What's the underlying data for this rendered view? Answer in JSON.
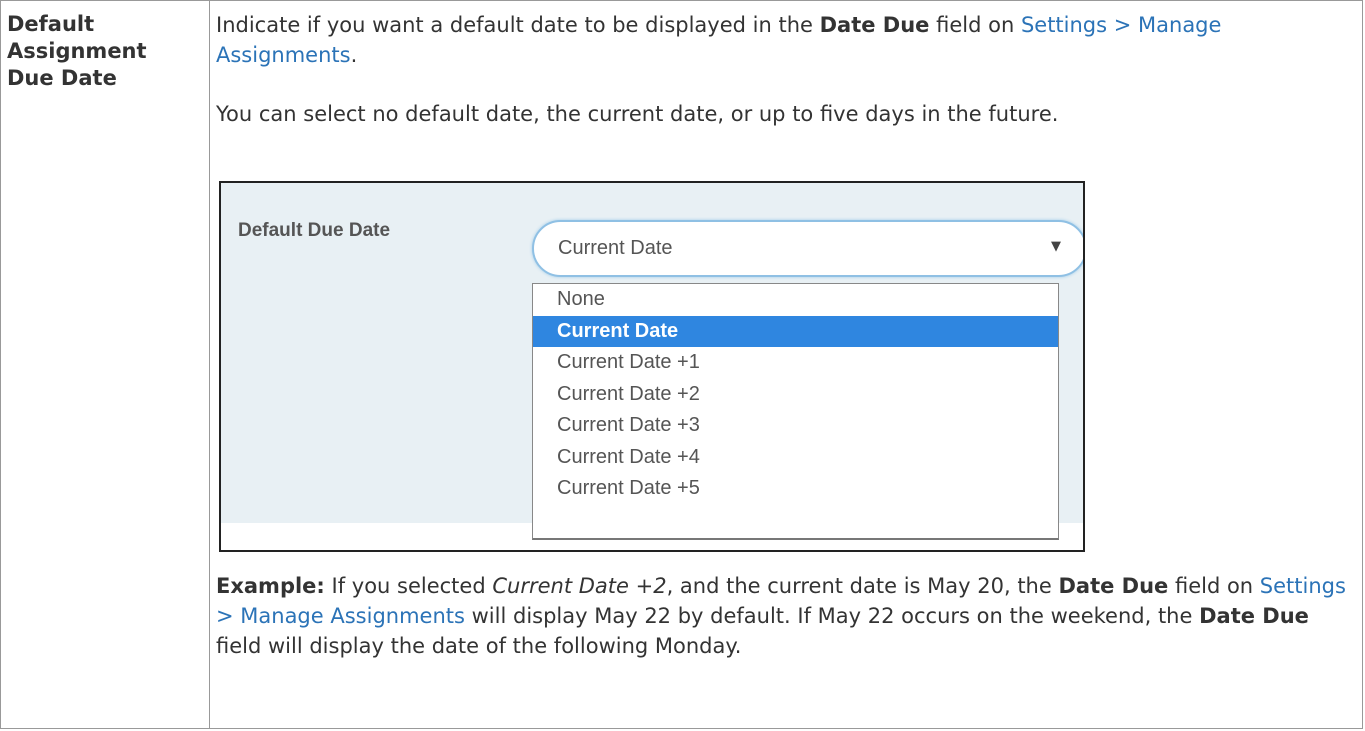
{
  "term": [
    "Default",
    "Assignment",
    "Due Date"
  ],
  "intro": {
    "pre": "Indicate if you want a default date to be displayed in the ",
    "bold": "Date Due",
    "mid": " field on ",
    "link": "Settings > Manage Assignments",
    "post": "."
  },
  "select_note": "You can select no default date, the current date, or up to five days in the future.",
  "dropdown": {
    "label": "Default Due Date",
    "value": "Current Date",
    "options": [
      "None",
      "Current Date",
      "Current Date +1",
      "Current Date +2",
      "Current Date +3",
      "Current Date +4",
      "Current Date +5"
    ],
    "selected_index": 1
  },
  "example": {
    "label": "Example:",
    "t1": " If you selected ",
    "italic": "Current Date +2",
    "t2": ", and the current date is May 20, the ",
    "bold1": "Date Due",
    "t3": " field on ",
    "link": "Settings > Manage Assignments",
    "t4": " will display May 22 by default. If May 22 occurs on the weekend, the ",
    "bold2": "Date Due",
    "t5": " field will display the date of the following Monday."
  },
  "colors": {
    "link": "#2b73b7",
    "selected_option": "#2f86e0",
    "screenshot_bg": "#e8f0f4"
  }
}
